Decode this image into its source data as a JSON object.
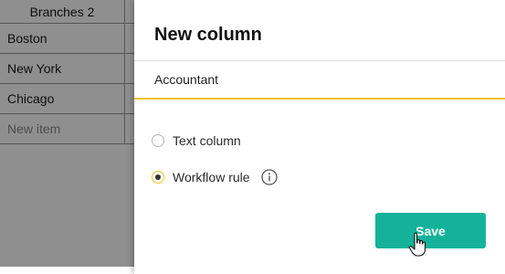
{
  "background_table": {
    "header": "Branches 2",
    "rows": [
      "Boston",
      "New York",
      "Chicago"
    ],
    "new_item_placeholder": "New item"
  },
  "dialog": {
    "title": "New column",
    "name_input_value": "Accountant",
    "options": [
      {
        "label": "Text column",
        "selected": false
      },
      {
        "label": "Workflow rule",
        "selected": true
      }
    ],
    "info_icon": "info-icon",
    "save_label": "Save"
  },
  "colors": {
    "accent_yellow": "#f0c419",
    "save_button": "#14b29b",
    "overlay": "rgba(0,0,0,0.44)"
  }
}
